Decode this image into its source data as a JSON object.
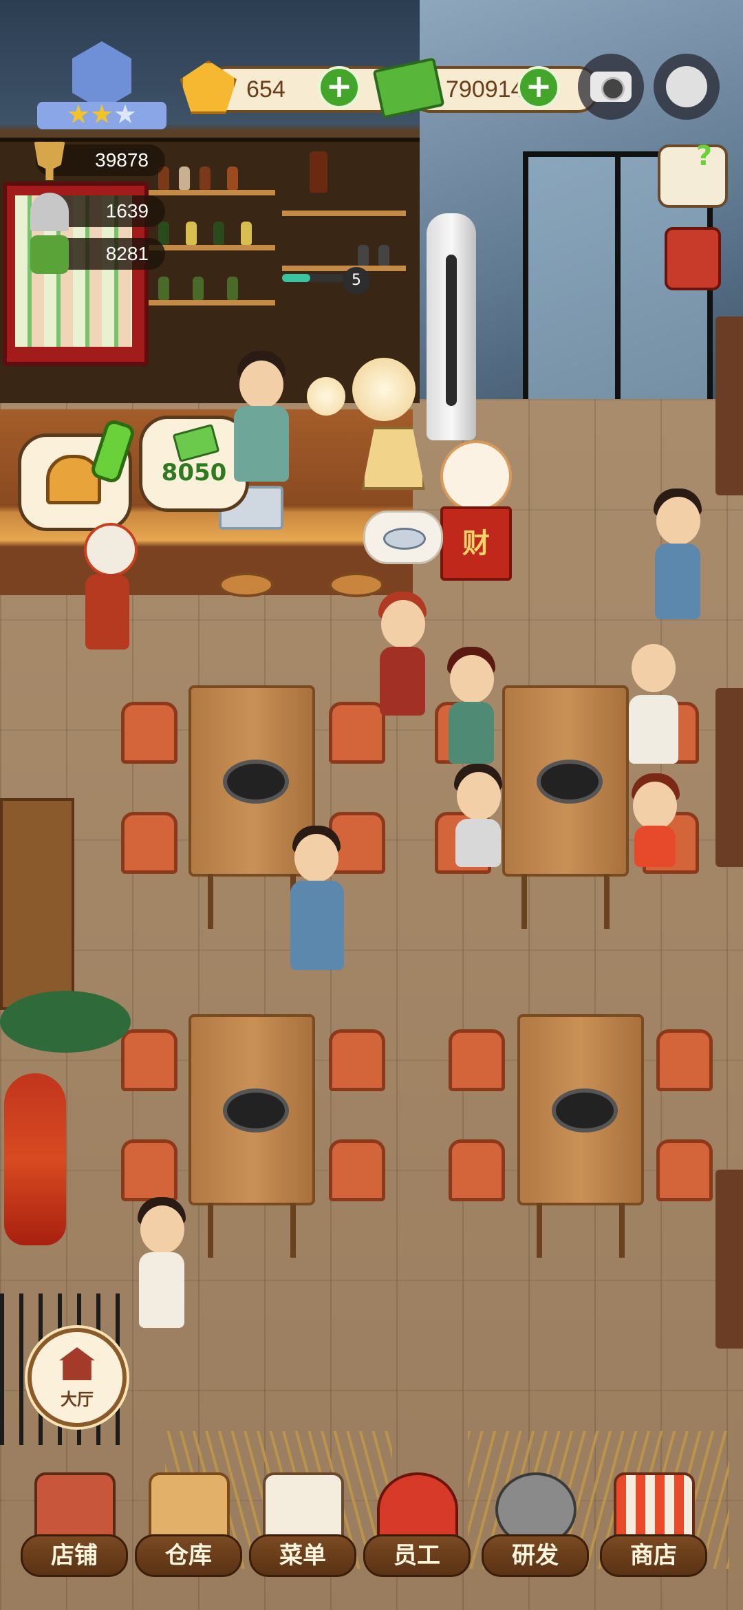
{
  "hud": {
    "gems": "654",
    "cash": "790914",
    "stars_filled": 2,
    "stars_total": 3
  },
  "stats": {
    "popularity": "39878",
    "dishes": "1639",
    "recipes": "8281"
  },
  "counter": {
    "tip_amount": "8050",
    "bottle_count": "5",
    "lucky_sign": "财"
  },
  "side_buttons": [
    {
      "icon": "guide-book-icon"
    },
    {
      "icon": "red-book-icon"
    }
  ],
  "hall_button": "大厅",
  "nav": [
    {
      "label": "店铺",
      "icon": "shop-building-icon"
    },
    {
      "label": "仓库",
      "icon": "warehouse-boxes-icon"
    },
    {
      "label": "菜单",
      "icon": "menu-clipboard-icon"
    },
    {
      "label": "员工",
      "icon": "staff-chef-icon"
    },
    {
      "label": "研发",
      "icon": "research-wok-icon"
    },
    {
      "label": "商店",
      "icon": "store-stall-icon"
    }
  ],
  "colors": {
    "accent_green": "#43a62b",
    "gem_gold": "#f5b830",
    "nav_brown": "#5a3214"
  }
}
